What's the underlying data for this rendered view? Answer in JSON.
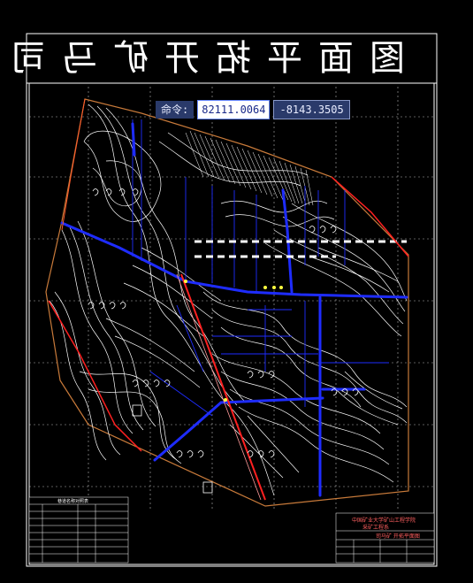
{
  "drawing": {
    "title": "图面平拓开矿马司"
  },
  "command_bar": {
    "label": "命令:",
    "x_value": "82111.0064",
    "y_value": "-8143.3505"
  },
  "title_block": {
    "line1": "中国矿业大学矿山工程学院",
    "line2": "采矿工程系",
    "drawing_name": "司马矿 开拓平面图"
  },
  "legend": {
    "title": "巷道名称对照表"
  },
  "colors": {
    "background": "#000000",
    "contour": "#ffffff",
    "roadway": "#1e2cff",
    "fault": "#ff2020",
    "boundary": "#c87a3a"
  }
}
